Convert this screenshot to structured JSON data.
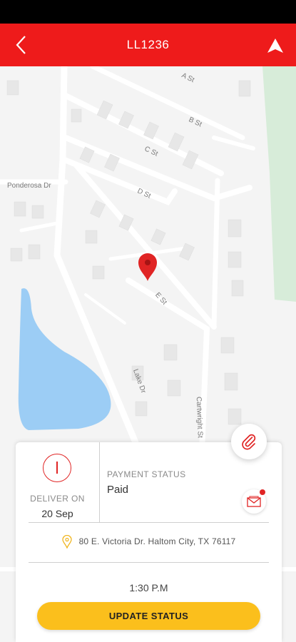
{
  "header": {
    "title": "LL1236",
    "back_icon": "chevron-left-icon",
    "nav_icon": "navigation-arrow-icon",
    "background": "#ee1b1b"
  },
  "map": {
    "streets": [
      "A St",
      "B St",
      "C St",
      "D St",
      "E St",
      "Ponderosa Dr",
      "Lake Dr",
      "Cartwright St"
    ],
    "marker_icon": "location-pin-icon",
    "marker_color": "#e02424",
    "water_color": "#9ccdf5",
    "park_color": "#d7ecd9"
  },
  "order": {
    "deliver_label": "DELIVER ON",
    "deliver_date": "20 Sep",
    "payment_label": "PAYMENT STATUS",
    "payment_value": "Paid",
    "address": "80 E. Victoria Dr. Haltom City, TX 76117",
    "time": "1:30 P.M",
    "update_label": "UPDATE STATUS",
    "accent": "#fbbf1c"
  }
}
